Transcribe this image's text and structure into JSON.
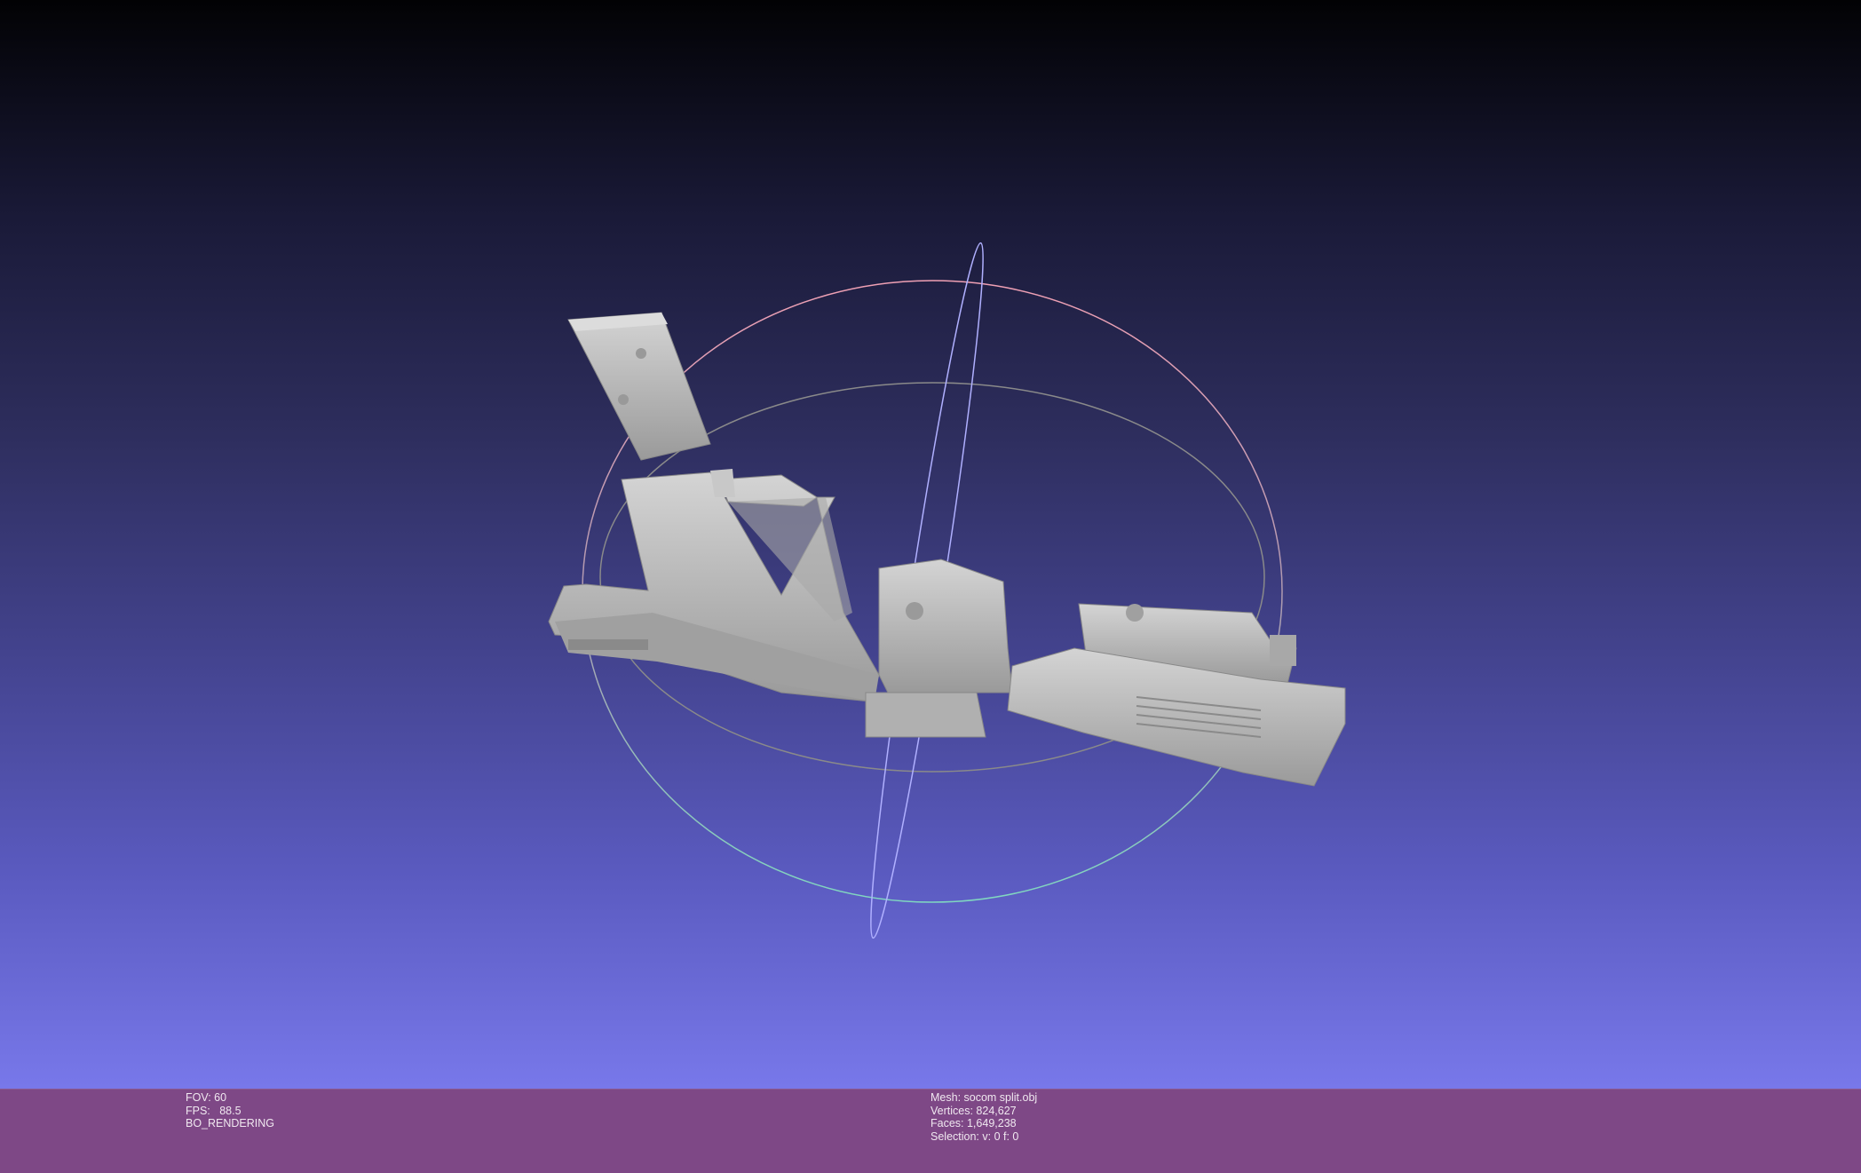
{
  "viewport": {
    "colors": {
      "gradient_top": "#020204",
      "gradient_bottom": "#7878ea",
      "mesh": "#b9b9b9"
    },
    "trackball": {
      "colors": {
        "x_ring": "#e6a0b0",
        "y_ring": "#a0a0ff",
        "z_ring": "#909090",
        "lower_ring": "#80d0c0"
      }
    }
  },
  "infobar": {
    "left": {
      "fov": "FOV: 60",
      "fps": "FPS:   88.5",
      "render_mode": "BO_RENDERING"
    },
    "right": {
      "mesh": "Mesh: socom split.obj",
      "vertices": "Vertices: 824,627",
      "faces": "Faces: 1,649,238",
      "selection": "Selection: v: 0 f: 0"
    },
    "color": "#7e4886"
  }
}
